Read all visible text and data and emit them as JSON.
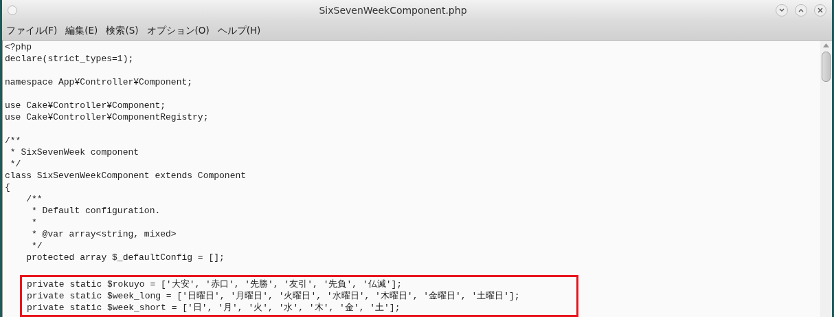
{
  "window": {
    "title": "SixSevenWeekComponent.php"
  },
  "menu": [
    {
      "label": "ファイル(F)"
    },
    {
      "label": "編集(E)"
    },
    {
      "label": "検索(S)"
    },
    {
      "label": "オプション(O)"
    },
    {
      "label": "ヘルプ(H)"
    }
  ],
  "editor": {
    "lines": [
      {
        "kind": "code",
        "text": "<?php"
      },
      {
        "kind": "code",
        "text": "declare(strict_types=1);"
      },
      {
        "kind": "blank"
      },
      {
        "kind": "code",
        "text": "namespace App¥Controller¥Component;"
      },
      {
        "kind": "blank"
      },
      {
        "kind": "code",
        "text": "use Cake¥Controller¥Component;"
      },
      {
        "kind": "code",
        "text": "use Cake¥Controller¥ComponentRegistry;"
      },
      {
        "kind": "blank"
      },
      {
        "kind": "code",
        "text": "/**"
      },
      {
        "kind": "code",
        "text": " * SixSevenWeek component"
      },
      {
        "kind": "code",
        "text": " */"
      },
      {
        "kind": "code",
        "text": "class SixSevenWeekComponent extends Component"
      },
      {
        "kind": "code",
        "text": "{"
      },
      {
        "kind": "code",
        "text": "    /**"
      },
      {
        "kind": "code",
        "text": "     * Default configuration."
      },
      {
        "kind": "code",
        "text": "     *"
      },
      {
        "kind": "code",
        "text": "     * @var array<string, mixed>"
      },
      {
        "kind": "code",
        "text": "     */"
      },
      {
        "kind": "code",
        "text": "    protected array $_defaultConfig = [];"
      },
      {
        "kind": "blank"
      }
    ],
    "highlight_frame": {
      "lines": [
        {
          "text": "private static $rokuyo = ['大安', '赤口', '先勝', '友引', '先負', '仏滅'];"
        },
        {
          "text": "private static $week_long = ['日曜日', '月曜日', '火曜日', '水曜日', '木曜日', '金曜日', '土曜日'];"
        },
        {
          "text": "private static $week_short = ['日', '月', '火', '水', '木', '金', '土'];"
        }
      ]
    }
  }
}
